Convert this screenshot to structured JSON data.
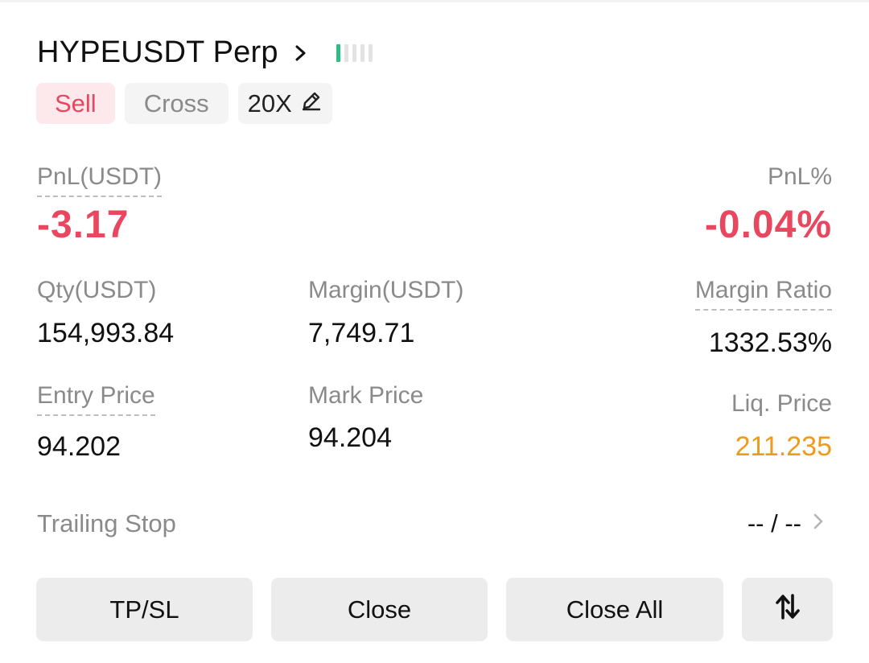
{
  "header": {
    "symbol": "HYPEUSDT Perp",
    "signal_bars_total": 5,
    "signal_bars_active": 1,
    "signal_color": "#2ebd85"
  },
  "tags": {
    "side": "Sell",
    "margin_mode": "Cross",
    "leverage": "20X",
    "edit_icon": "pencil-icon"
  },
  "pnl": {
    "label": "PnL(USDT)",
    "value": "-3.17",
    "pct_label": "PnL%",
    "pct_value": "-0.04%",
    "color": "#e8475f"
  },
  "stats": {
    "qty_label": "Qty(USDT)",
    "qty_value": "154,993.84",
    "margin_label": "Margin(USDT)",
    "margin_value": "7,749.71",
    "margin_ratio_label": "Margin Ratio",
    "margin_ratio_value": "1332.53%",
    "entry_label": "Entry Price",
    "entry_value": "94.202",
    "mark_label": "Mark Price",
    "mark_value": "94.204",
    "liq_label": "Liq. Price",
    "liq_value": "211.235",
    "liq_color": "#ef9a1c"
  },
  "trailing": {
    "label": "Trailing Stop",
    "value": "-- / --"
  },
  "actions": {
    "tpsl": "TP/SL",
    "close": "Close",
    "close_all": "Close All",
    "reverse_icon": "swap-arrows-icon"
  }
}
